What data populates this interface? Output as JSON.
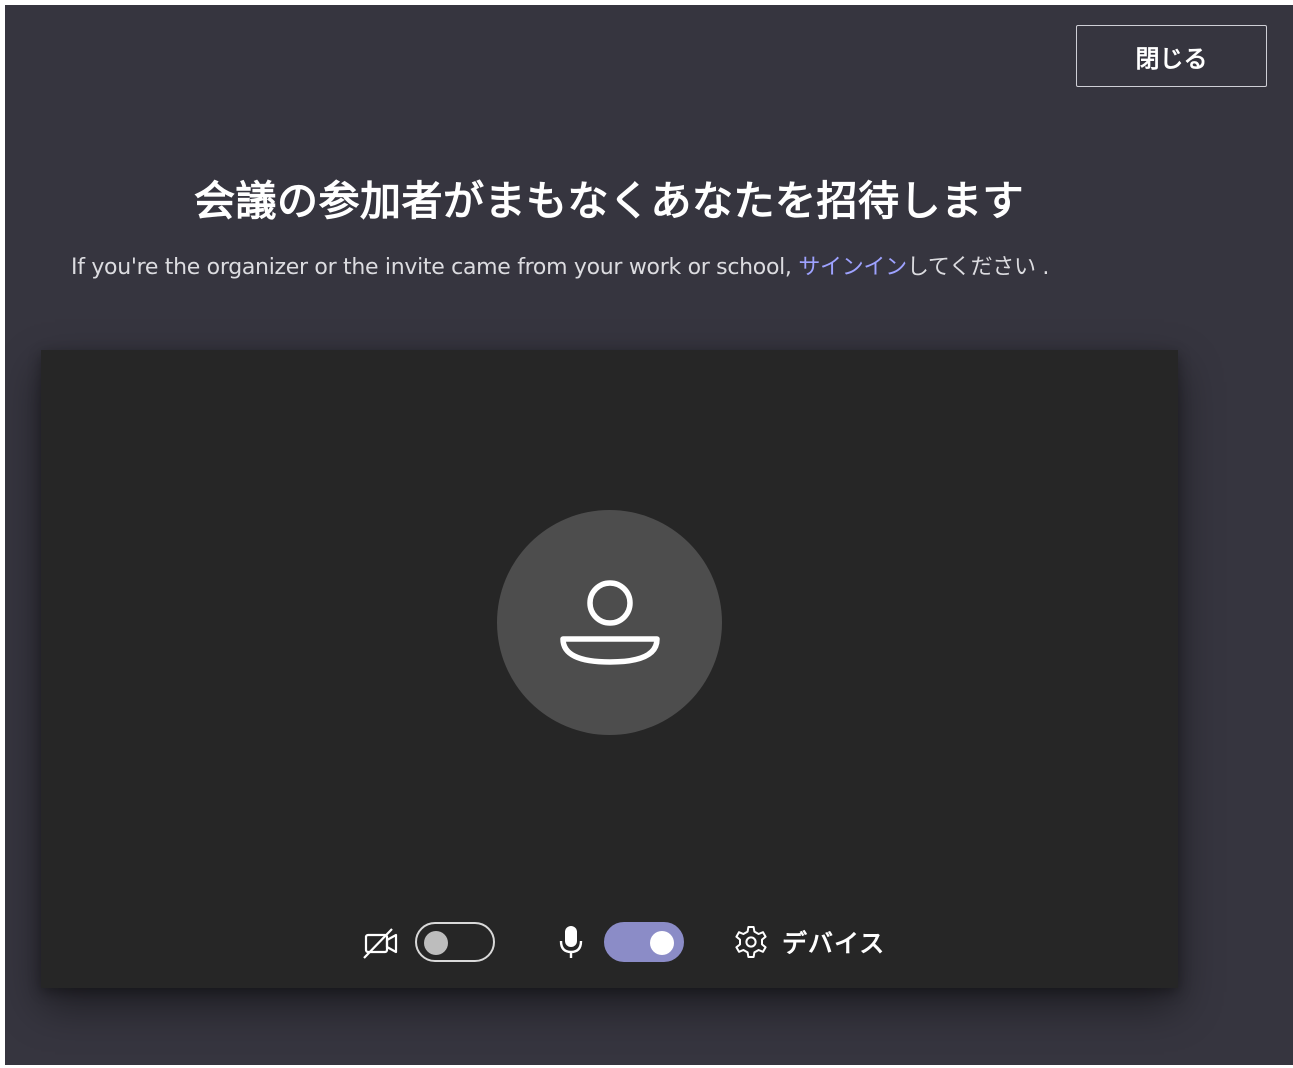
{
  "header": {
    "close_label": "閉じる"
  },
  "main": {
    "title": "会議の参加者がまもなくあなたを招待します",
    "subtitle_prefix": "If you're the organizer or the invite came from your work or school, ",
    "signin_link": "サインイン",
    "subtitle_suffix": "してください ."
  },
  "controls": {
    "camera": {
      "icon": "camera-off-icon",
      "enabled": false
    },
    "microphone": {
      "icon": "microphone-icon",
      "enabled": true
    },
    "devices": {
      "icon": "gear-icon",
      "label": "デバイス"
    }
  },
  "avatar": {
    "icon": "person-icon"
  },
  "colors": {
    "background": "#36353f",
    "preview": "#262626",
    "avatar": "#4d4d4d",
    "accent": "#8b8cc7",
    "link": "#9ea2ff"
  }
}
